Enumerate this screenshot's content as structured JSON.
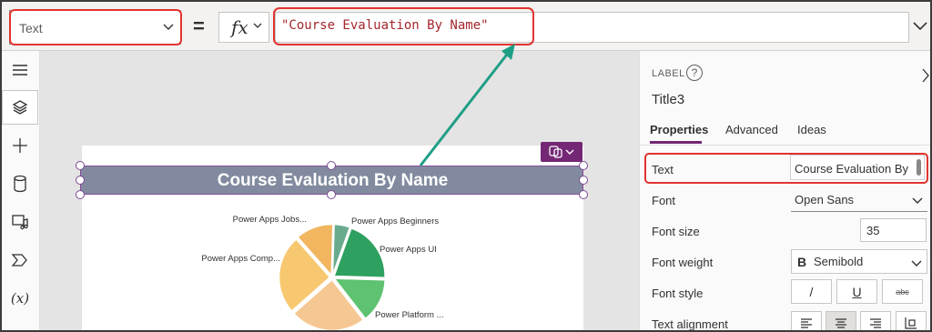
{
  "formula_bar": {
    "property_selected": "Text",
    "equals": "=",
    "fx_label": "fx",
    "formula": "\"Course Evaluation By Name\""
  },
  "left_rail": {
    "items": [
      "menu-icon",
      "layers-icon",
      "insert-icon",
      "data-icon",
      "media-icon",
      "power-automate-icon",
      "variables-icon"
    ],
    "variables_label": "(x)"
  },
  "canvas": {
    "title_text": "Course Evaluation By Name",
    "chart_data": {
      "type": "pie",
      "categories": [
        "Power Apps Beginners",
        "Power Apps UI",
        "Power Platform ...",
        "",
        "Power Apps Comp...",
        "Power Apps Jobs..."
      ],
      "values": [
        5,
        20,
        14,
        24,
        25,
        12
      ],
      "colors": [
        "#6aab8e",
        "#2ea05f",
        "#5ec270",
        "#f5c793",
        "#f7c870",
        "#f2b560"
      ],
      "title": "",
      "legend": "none"
    }
  },
  "right_panel": {
    "type_label": "LABEL",
    "help": "?",
    "control_name": "Title3",
    "tabs": [
      "Properties",
      "Advanced",
      "Ideas"
    ],
    "active_tab": "Properties",
    "properties": {
      "text_label": "Text",
      "text_value": "Course Evaluation By",
      "font_label": "Font",
      "font_value": "Open Sans",
      "font_size_label": "Font size",
      "font_size_value": "35",
      "font_weight_label": "Font weight",
      "font_weight_icon": "B",
      "font_weight_value": "Semibold",
      "font_style_label": "Font style",
      "italic": "/",
      "underline": "U",
      "strikethrough": "abc",
      "text_alignment_label": "Text alignment"
    }
  },
  "colors": {
    "accent": "#742774",
    "highlight": "#e0342f",
    "title_bar": "#818a9e",
    "arrow": "#1f9e85",
    "formula_text": "#a4262c"
  }
}
